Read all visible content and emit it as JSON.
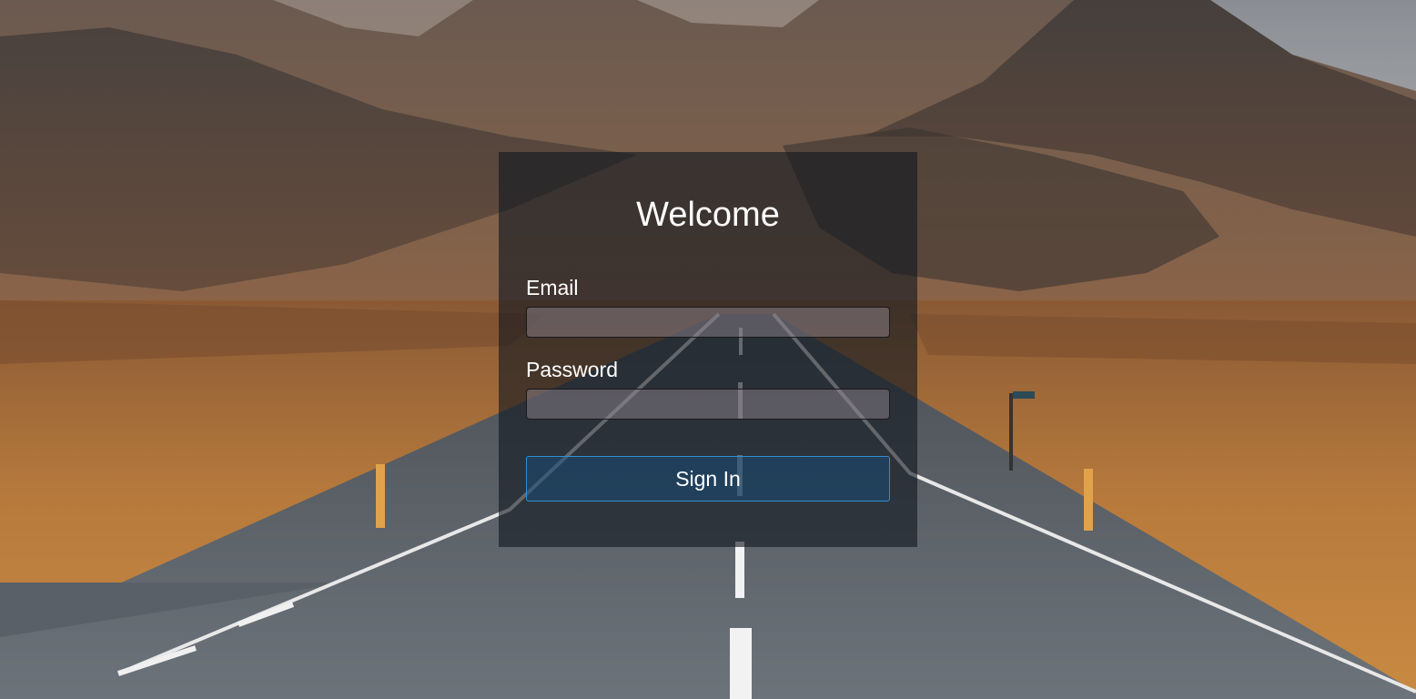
{
  "page": {
    "heading": "Welcome"
  },
  "form": {
    "email_label": "Email",
    "email_value": "",
    "password_label": "Password",
    "password_value": "",
    "submit_label": "Sign In"
  },
  "background": {
    "description_icon": "mountain-road-photo"
  }
}
